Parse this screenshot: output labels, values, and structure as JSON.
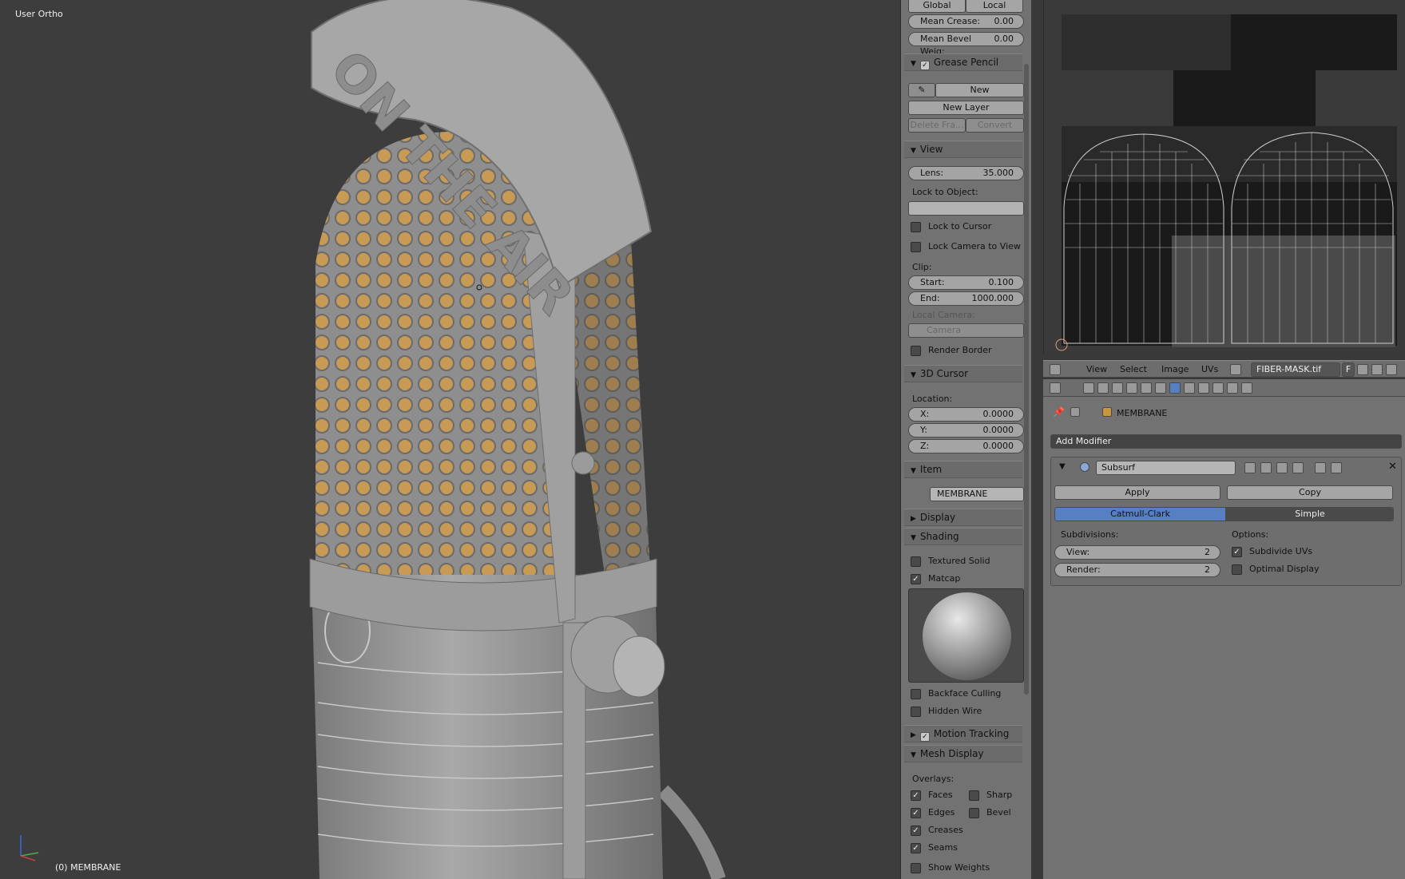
{
  "viewport": {
    "label": "User Ortho",
    "object_label": "(0) MEMBRANE",
    "stamp": "ON THE AIR"
  },
  "npanel": {
    "toggle_global": "Global",
    "toggle_local": "Local",
    "mean_crease_label": "Mean Crease:",
    "mean_crease_value": "0.00",
    "mean_bevel_label": "Mean Bevel Weig:",
    "mean_bevel_value": "0.00",
    "grease_pencil": {
      "title": "Grease Pencil",
      "new_label": "New",
      "new_layer": "New Layer",
      "delete_frame": "Delete Fra...",
      "convert": "Convert"
    },
    "view": {
      "title": "View",
      "lens_label": "Lens:",
      "lens_value": "35.000",
      "lock_to_object": "Lock to Object:",
      "lock_to_cursor": "Lock to Cursor",
      "lock_camera": "Lock Camera to View",
      "clip": "Clip:",
      "start_label": "Start:",
      "start_value": "0.100",
      "end_label": "End:",
      "end_value": "1000.000",
      "local_camera": "Local Camera:",
      "camera": "Camera",
      "render_border": "Render Border"
    },
    "cursor": {
      "title": "3D Cursor",
      "location": "Location:",
      "x_label": "X:",
      "x_value": "0.0000",
      "y_label": "Y:",
      "y_value": "0.0000",
      "z_label": "Z:",
      "z_value": "0.0000"
    },
    "item": {
      "title": "Item",
      "name": "MEMBRANE"
    },
    "display_title": "Display",
    "shading": {
      "title": "Shading",
      "textured_solid": "Textured Solid",
      "matcap": "Matcap",
      "backface_culling": "Backface Culling",
      "hidden_wire": "Hidden Wire"
    },
    "motion_tracking": "Motion Tracking",
    "mesh_display": {
      "title": "Mesh Display",
      "overlays": "Overlays:",
      "faces": "Faces",
      "sharp": "Sharp",
      "edges": "Edges",
      "bevel": "Bevel",
      "creases": "Creases",
      "seams": "Seams",
      "show_weights": "Show Weights"
    }
  },
  "uv_editor": {
    "menu": [
      "View",
      "Select",
      "Image",
      "UVs"
    ],
    "image_name": "FIBER-MASK.tif",
    "fake_user": "F"
  },
  "properties": {
    "object_name": "MEMBRANE",
    "add_modifier": "Add Modifier",
    "modifier": {
      "name": "Subsurf",
      "apply": "Apply",
      "copy": "Copy",
      "catmull": "Catmull-Clark",
      "simple": "Simple",
      "subdivisions": "Subdivisions:",
      "view_label": "View:",
      "view_value": "2",
      "render_label": "Render:",
      "render_value": "2",
      "options": "Options:",
      "subdivide_uvs": "Subdivide UVs",
      "optimal_display": "Optimal Display"
    }
  },
  "colors": {
    "accent_blue": "#5680c2",
    "orange": "#c8963c"
  }
}
